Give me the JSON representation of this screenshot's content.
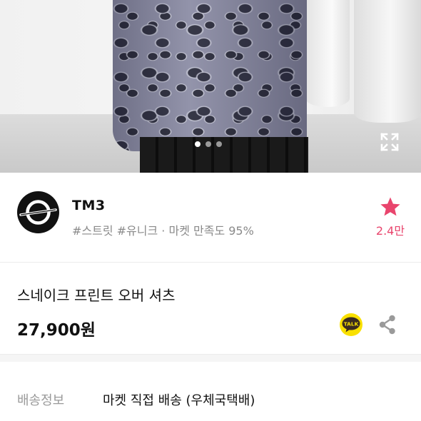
{
  "seller": {
    "name": "TM3",
    "tags": "#스트릿 #유니크 · 마켓 만족도 95%",
    "favorite_count": "2.4만"
  },
  "product": {
    "title": "스네이크 프린트 오버 셔츠",
    "price": "27,900원"
  },
  "gallery": {
    "slide_count": 3,
    "active_slide": 1
  },
  "actions": {
    "talk_label": "TALK"
  },
  "shipping": {
    "label": "배송정보",
    "value": "마켓 직접 배송 (우체국택배)"
  },
  "colors": {
    "accent": "#e9456d",
    "talk_bubble": "#3a2b20",
    "talk_yellow": "#f9e000"
  },
  "icons": [
    "expand-icon",
    "star-icon",
    "talk-icon",
    "share-icon",
    "seller-logo"
  ]
}
